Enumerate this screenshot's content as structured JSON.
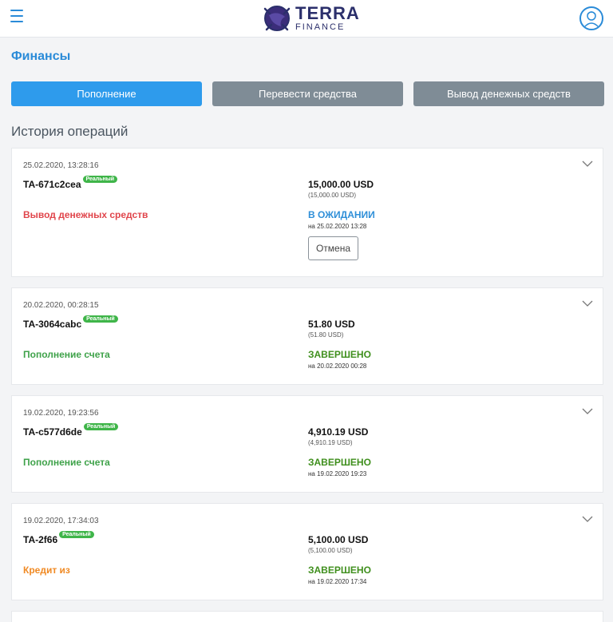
{
  "header": {
    "logo_line1": "TERRA",
    "logo_line2": "FINANCE"
  },
  "page_title": "Финансы",
  "actions": {
    "deposit": "Пополнение",
    "transfer": "Перевести средства",
    "withdraw": "Вывод денежных средств"
  },
  "history_title": "История операций",
  "transactions": [
    {
      "date": "25.02.2020, 13:28:16",
      "id": "TA-671c2cea",
      "badge": "Реальный",
      "type": "Вывод денежных средств",
      "amount": "15,000.00 USD",
      "amount_sub": "(15,000.00 USD)",
      "status": "В ОЖИДАНИИ",
      "status_date": "на 25.02.2020 13:28",
      "cancel_label": "Отмена"
    },
    {
      "date": "20.02.2020, 00:28:15",
      "id": "TA-3064cabc",
      "badge": "Реальный",
      "type": "Пополнение счета",
      "amount": "51.80 USD",
      "amount_sub": "(51.80 USD)",
      "status": "ЗАВЕРШЕНО",
      "status_date": "на 20.02.2020 00:28"
    },
    {
      "date": "19.02.2020, 19:23:56",
      "id": "TA-c577d6de",
      "badge": "Реальный",
      "type": "Пополнение счета",
      "amount": "4,910.19 USD",
      "amount_sub": "(4,910.19 USD)",
      "status": "ЗАВЕРШЕНО",
      "status_date": "на 19.02.2020 19:23"
    },
    {
      "date": "19.02.2020, 17:34:03",
      "id": "TA-2f66",
      "badge": "Реальный",
      "type": "Кредит из",
      "amount": "5,100.00 USD",
      "amount_sub": "(5,100.00 USD)",
      "status": "ЗАВЕРШЕНО",
      "status_date": "на 19.02.2020 17:34"
    }
  ],
  "colors": {
    "accent": "#2a8bd8",
    "withdraw_type": "#e0454b",
    "deposit_type": "#3fa24a",
    "credit_type": "#f08a24",
    "pending_status": "#2f8fd8",
    "completed_status": "#3f8f1d",
    "badge": "#3fb549"
  }
}
